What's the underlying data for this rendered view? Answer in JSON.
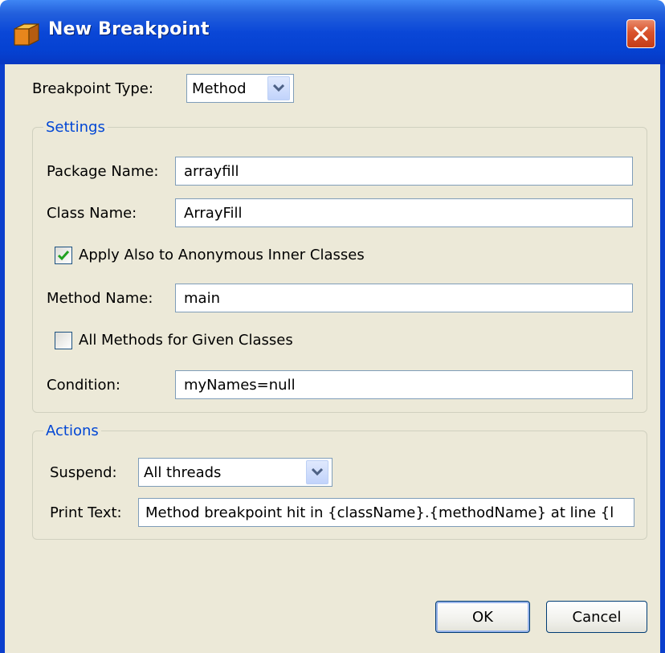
{
  "window": {
    "title": "New Breakpoint"
  },
  "breakpoint_type": {
    "label": "Breakpoint Type:",
    "value": "Method"
  },
  "settings": {
    "title": "Settings",
    "package_name": {
      "label": "Package Name:",
      "value": "arrayfill"
    },
    "class_name": {
      "label": "Class Name:",
      "value": "ArrayFill"
    },
    "apply_inner": {
      "label": "Apply Also to Anonymous Inner Classes",
      "checked": true
    },
    "method_name": {
      "label": "Method Name:",
      "value": "main"
    },
    "all_methods": {
      "label": "All Methods for Given Classes",
      "checked": false
    },
    "condition": {
      "label": "Condition:",
      "value": "myNames=null"
    }
  },
  "actions": {
    "title": "Actions",
    "suspend": {
      "label": "Suspend:",
      "value": "All threads"
    },
    "print_text": {
      "label": "Print Text:",
      "value": "Method breakpoint hit in {className}.{methodName} at line {l"
    }
  },
  "buttons": {
    "ok": "OK",
    "cancel": "Cancel"
  },
  "icons": [
    "app-icon",
    "close-icon",
    "chevron-down-icon",
    "checkmark-icon"
  ]
}
